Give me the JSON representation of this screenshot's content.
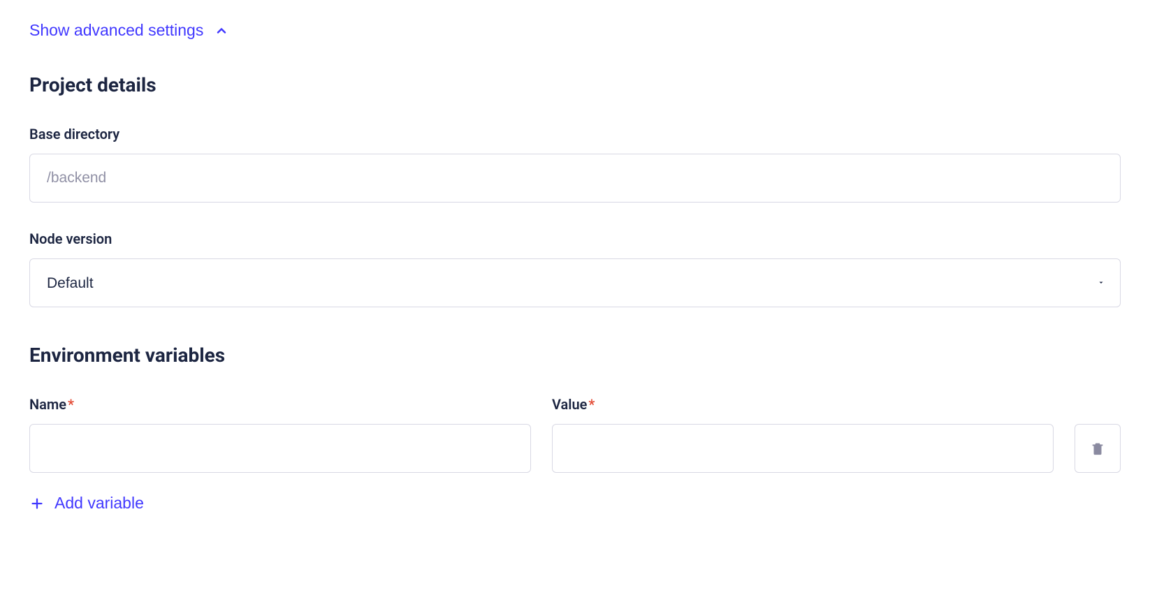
{
  "advanced_toggle": {
    "label": "Show advanced settings"
  },
  "project_details": {
    "heading": "Project details",
    "base_directory": {
      "label": "Base directory",
      "placeholder": "/backend",
      "value": ""
    },
    "node_version": {
      "label": "Node version",
      "selected": "Default"
    }
  },
  "env_vars": {
    "heading": "Environment variables",
    "columns": {
      "name": "Name",
      "value": "Value"
    },
    "rows": [
      {
        "name": "",
        "value": ""
      }
    ],
    "add_label": "Add variable"
  }
}
